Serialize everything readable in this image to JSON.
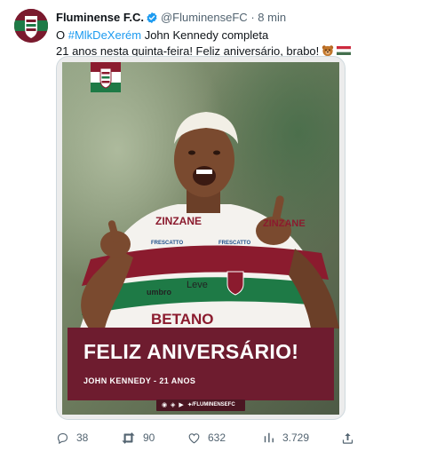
{
  "tweet": {
    "author": {
      "display_name": "Fluminense F.C.",
      "handle": "@FluminenseFC",
      "separator": "·",
      "time": "8 min",
      "verified": true
    },
    "text": {
      "prefix": "O ",
      "hashtag": "#MlkDeXerém",
      "line1_rest": " John Kennedy completa",
      "line2": "21 anos nesta quinta-feira! Feliz aniversário, brabo!",
      "emojis": [
        "bear-face-emoji",
        "hungary-flag-emoji"
      ]
    },
    "media": {
      "banner_title": "FELIZ ANIVERSÁRIO!",
      "banner_subtitle": "JOHN KENNEDY - 21 ANOS",
      "social_handle": "/FLUMINENSEFC",
      "jersey_texts": [
        "ZINZANE",
        "ZINZANE",
        "FRESCATTO",
        "FRESCATTO",
        "umbro",
        "Leve",
        "BETANO"
      ],
      "colors": {
        "grena": "#6e1c2f",
        "green": "#1e7a46",
        "white": "#ffffff"
      }
    },
    "metrics": {
      "replies": "38",
      "retweets": "90",
      "likes": "632",
      "views": "3.729"
    }
  }
}
